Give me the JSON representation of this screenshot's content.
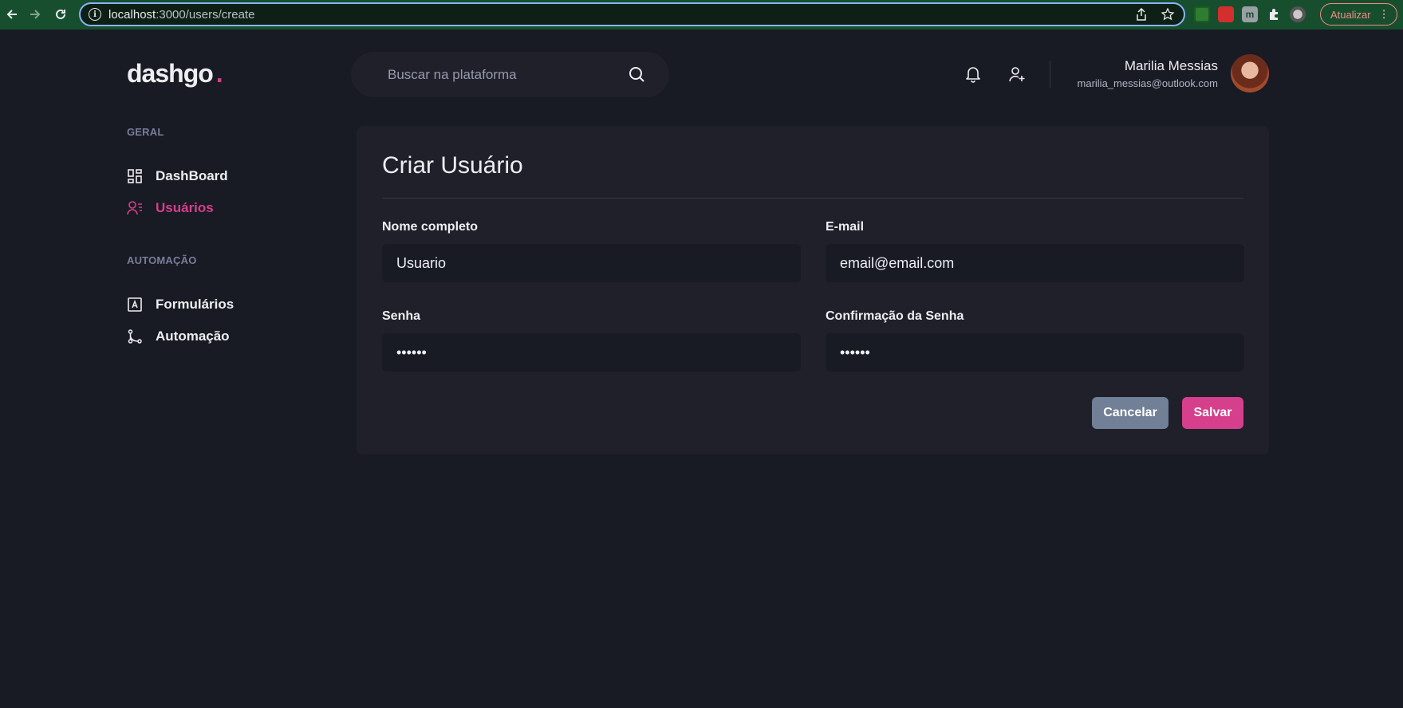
{
  "browser": {
    "url_host": "localhost",
    "url_path": ":3000/users/create",
    "update_label": "Atualizar"
  },
  "app": {
    "logo": "dashgo",
    "logo_dot": "."
  },
  "search": {
    "placeholder": "Buscar na plataforma"
  },
  "user": {
    "name": "Marilia Messias",
    "email": "marilia_messias@outlook.com"
  },
  "sidebar": {
    "sections": [
      {
        "title": "GERAL",
        "items": [
          {
            "label": "DashBoard",
            "icon": "dashboard-icon",
            "active": false
          },
          {
            "label": "Usuários",
            "icon": "users-icon",
            "active": true
          }
        ]
      },
      {
        "title": "AUTOMAÇÃO",
        "items": [
          {
            "label": "Formulários",
            "icon": "form-icon",
            "active": false
          },
          {
            "label": "Automação",
            "icon": "automation-icon",
            "active": false
          }
        ]
      }
    ]
  },
  "form": {
    "title": "Criar Usuário",
    "fields": {
      "name": {
        "label": "Nome completo",
        "value": "Usuario"
      },
      "email": {
        "label": "E-mail",
        "value": "email@email.com"
      },
      "password": {
        "label": "Senha",
        "value": "••••••"
      },
      "password_confirm": {
        "label": "Confirmação da Senha",
        "value": "••••••"
      }
    },
    "cancel_label": "Cancelar",
    "save_label": "Salvar"
  },
  "colors": {
    "background": "#181b23",
    "card": "#1f2029",
    "accent": "#d53f8c",
    "muted": "#797d9a",
    "cancel": "#718096"
  }
}
